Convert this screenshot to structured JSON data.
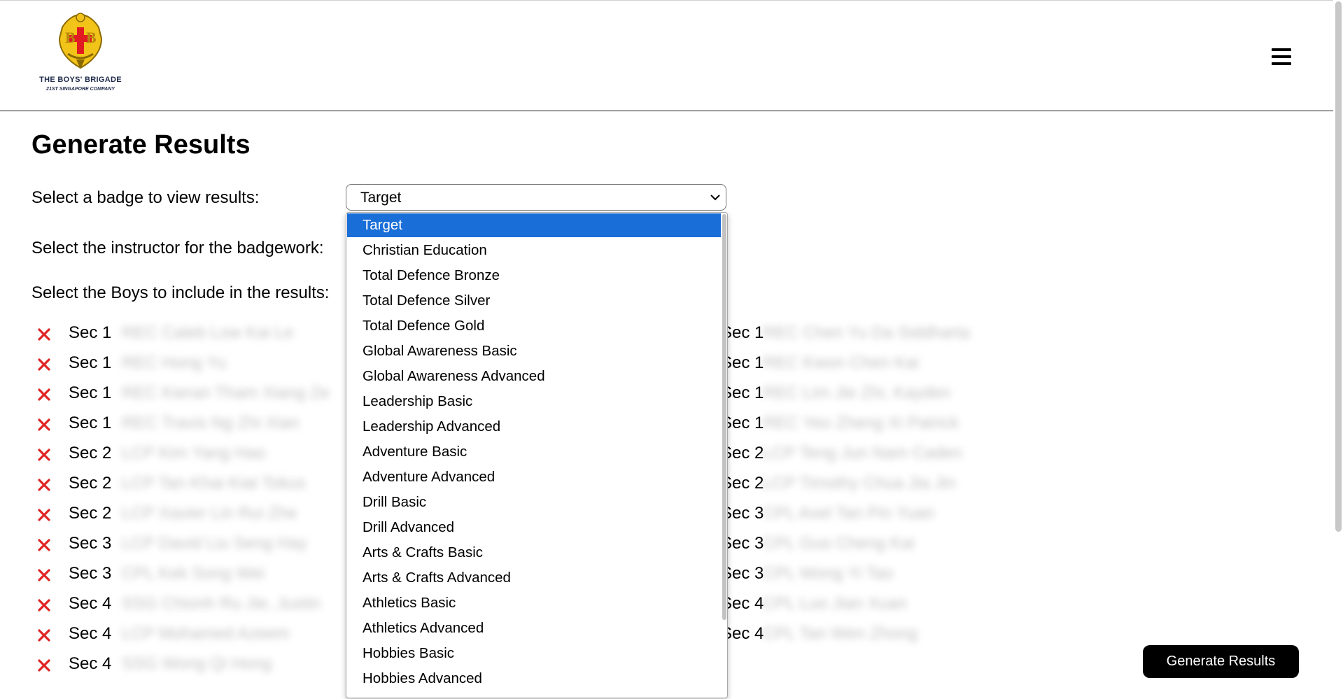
{
  "header": {
    "logo_line1": "THE BOYS' BRIGADE",
    "logo_line2": "21ST SINGAPORE COMPANY",
    "logo_icon": "boys-brigade-crest",
    "menu_icon": "hamburger-menu-icon"
  },
  "page": {
    "title": "Generate Results",
    "badge_label": "Select a badge to view results:",
    "instructor_label": "Select the instructor for the badgework:",
    "boys_label": "Select the Boys to include in the results:"
  },
  "badge_select": {
    "value": "Target",
    "options": [
      "Target",
      "Christian Education",
      "Total Defence Bronze",
      "Total Defence Silver",
      "Total Defence Gold",
      "Global Awareness Basic",
      "Global Awareness Advanced",
      "Leadership Basic",
      "Leadership Advanced",
      "Adventure Basic",
      "Adventure Advanced",
      "Drill Basic",
      "Drill Advanced",
      "Arts & Crafts Basic",
      "Arts & Crafts Advanced",
      "Athletics Basic",
      "Athletics Advanced",
      "Hobbies Basic",
      "Hobbies Advanced"
    ]
  },
  "boys_col1": [
    {
      "sec": "Sec 1",
      "name": "REC Caleb Low Kai Le"
    },
    {
      "sec": "Sec 1",
      "name": "REC Hong Yu"
    },
    {
      "sec": "Sec 1",
      "name": "REC Kieran Tham Xiang Ze"
    },
    {
      "sec": "Sec 1",
      "name": "REC Travis Ng Zhi Xian"
    },
    {
      "sec": "Sec 2",
      "name": "LCP Kim Yang Hao"
    },
    {
      "sec": "Sec 2",
      "name": "LCP Tan Khai Kiat Tokus"
    },
    {
      "sec": "Sec 2",
      "name": "LCP Xavier Lin Rui Zhe"
    },
    {
      "sec": "Sec 3",
      "name": "LCP David Liu Seng Hay"
    },
    {
      "sec": "Sec 3",
      "name": "CPL Kek Song Wei"
    },
    {
      "sec": "Sec 4",
      "name": "SSG Chionh Ru Jie, Justin"
    },
    {
      "sec": "Sec 4",
      "name": "LCP Mohamed Azeem"
    },
    {
      "sec": "Sec 4",
      "name": "SSG Wong Qi Hong"
    }
  ],
  "boys_col2": [
    {
      "sec": "Sec 1",
      "name": "REC Chen Yu Da Siddharta"
    },
    {
      "sec": "Sec 1",
      "name": "REC Kwon Chen Kai"
    },
    {
      "sec": "Sec 1",
      "name": "REC Lim Jie Zhi, Kayden"
    },
    {
      "sec": "Sec 1",
      "name": "REC Yeo Zheng Xi Patrick"
    },
    {
      "sec": "Sec 2",
      "name": "LCP Teng Jun Nam Caden"
    },
    {
      "sec": "Sec 2",
      "name": "LCP Timothy Chua Jia Jin"
    },
    {
      "sec": "Sec 3",
      "name": "CPL Axel Tan Pin Yuan"
    },
    {
      "sec": "Sec 3",
      "name": "CPL Guo Cheng Kai"
    },
    {
      "sec": "Sec 3",
      "name": "CPL Wong Yi Tao"
    },
    {
      "sec": "Sec 4",
      "name": "CPL Luo Jian Xuan"
    },
    {
      "sec": "Sec 4",
      "name": "CPL Tan Wen Zhong"
    }
  ],
  "actions": {
    "generate_label": "Generate Results"
  },
  "colors": {
    "accent_selected": "#1a6ed8",
    "remove_icon": "#e02424",
    "button_bg": "#000000"
  }
}
